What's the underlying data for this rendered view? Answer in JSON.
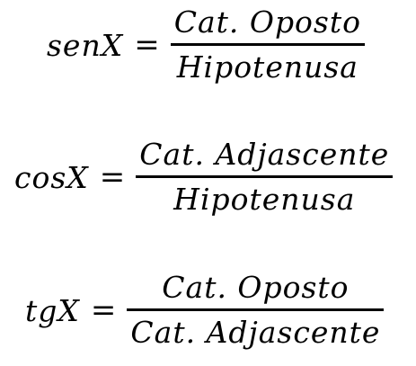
{
  "formulas": [
    {
      "lhs": "senX",
      "equals": "=",
      "numerator": "Cat. Oposto",
      "denominator": "Hipotenusa"
    },
    {
      "lhs": "cosX",
      "equals": "=",
      "numerator": "Cat. Adjascente",
      "denominator": "Hipotenusa"
    },
    {
      "lhs": "tgX",
      "equals": "=",
      "numerator": "Cat. Oposto",
      "denominator": "Cat. Adjascente"
    }
  ]
}
